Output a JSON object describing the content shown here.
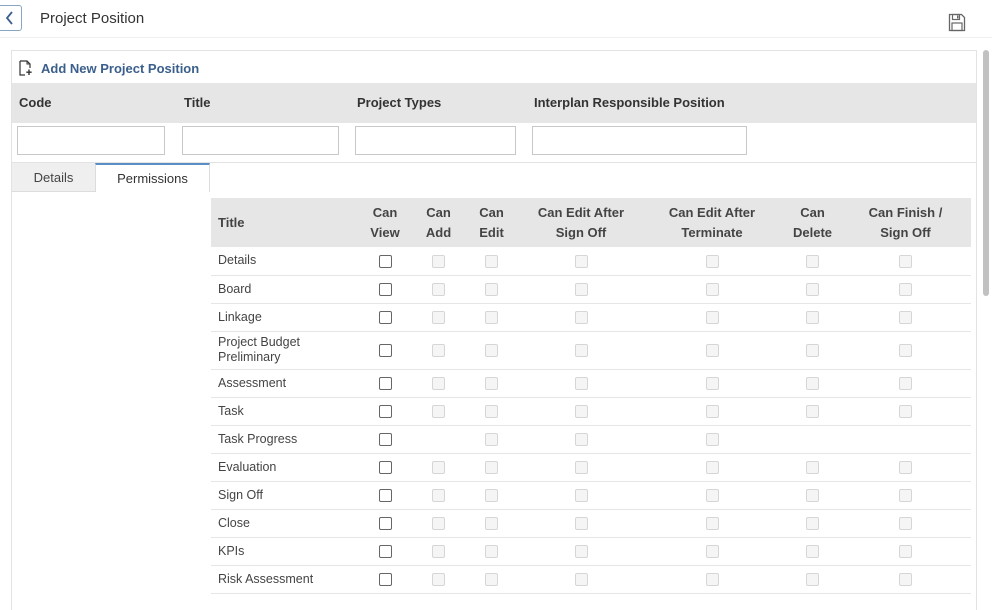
{
  "header": {
    "title": "Project Position",
    "back_icon": "chevron-left-icon",
    "save_icon": "floppy-disk-icon"
  },
  "toolbar": {
    "add_label": "Add New Project Position",
    "add_icon": "file-add-icon"
  },
  "filters": {
    "columns": [
      "Code",
      "Title",
      "Project Types",
      "Interplan Responsible Position"
    ],
    "values": [
      "",
      "",
      "",
      ""
    ]
  },
  "tabs": [
    {
      "label": "Details",
      "active": false
    },
    {
      "label": "Permissions",
      "active": true
    }
  ],
  "permissions": {
    "columns": [
      [
        "Title"
      ],
      [
        "Can",
        "View"
      ],
      [
        "Can",
        "Add"
      ],
      [
        "Can",
        "Edit"
      ],
      [
        "Can Edit After",
        "Sign Off"
      ],
      [
        "Can Edit After",
        "Terminate"
      ],
      [
        "Can",
        "Delete"
      ],
      [
        "Can Finish /",
        "Sign Off"
      ]
    ],
    "rows": [
      {
        "title": "Details",
        "flags": [
          "on",
          "off",
          "off",
          "off",
          "off",
          "off",
          "off"
        ]
      },
      {
        "title": "Board",
        "flags": [
          "on",
          "off",
          "off",
          "off",
          "off",
          "off",
          "off"
        ]
      },
      {
        "title": "Linkage",
        "flags": [
          "on",
          "off",
          "off",
          "off",
          "off",
          "off",
          "off"
        ]
      },
      {
        "title": "Project Budget Preliminary",
        "flags": [
          "on",
          "off",
          "off",
          "off",
          "off",
          "off",
          "off"
        ]
      },
      {
        "title": "Assessment",
        "flags": [
          "on",
          "off",
          "off",
          "off",
          "off",
          "off",
          "off"
        ]
      },
      {
        "title": "Task",
        "flags": [
          "on",
          "off",
          "off",
          "off",
          "off",
          "off",
          "off"
        ]
      },
      {
        "title": "Task Progress",
        "flags": [
          "on",
          "none",
          "off",
          "off",
          "off",
          "none",
          "none"
        ]
      },
      {
        "title": "Evaluation",
        "flags": [
          "on",
          "off",
          "off",
          "off",
          "off",
          "off",
          "off"
        ]
      },
      {
        "title": "Sign Off",
        "flags": [
          "on",
          "off",
          "off",
          "off",
          "off",
          "off",
          "off"
        ]
      },
      {
        "title": "Close",
        "flags": [
          "on",
          "off",
          "off",
          "off",
          "off",
          "off",
          "off"
        ]
      },
      {
        "title": "KPIs",
        "flags": [
          "on",
          "off",
          "off",
          "off",
          "off",
          "off",
          "off"
        ]
      },
      {
        "title": "Risk Assessment",
        "flags": [
          "on",
          "off",
          "off",
          "off",
          "off",
          "off",
          "off"
        ]
      }
    ]
  }
}
